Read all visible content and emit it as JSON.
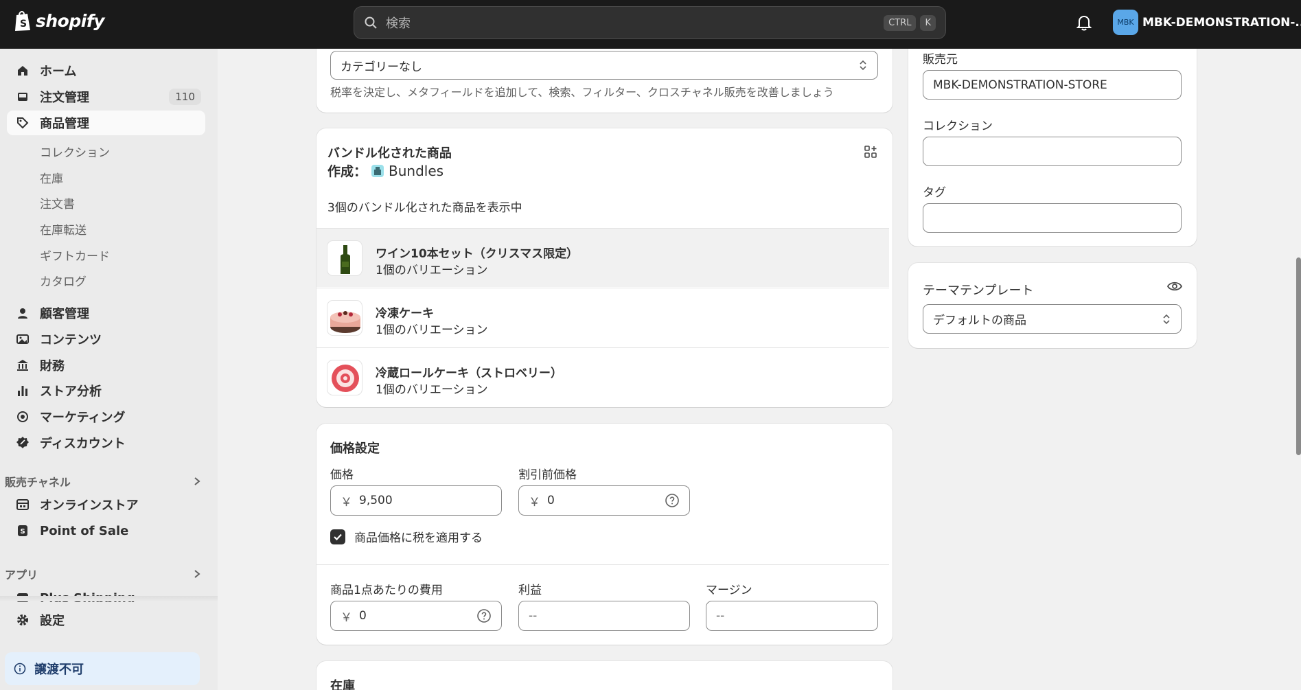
{
  "topbar": {
    "brand": "shopify",
    "search_placeholder": "検索",
    "shortcut_keys": [
      "CTRL",
      "K"
    ],
    "store_avatar": "MBK",
    "store_name": "MBK-DEMONSTRATION-..."
  },
  "sidebar": {
    "items": [
      {
        "label": "ホーム",
        "icon": "home-icon"
      },
      {
        "label": "注文管理",
        "icon": "inbox-icon",
        "badge": "110"
      },
      {
        "label": "商品管理",
        "icon": "tag-icon"
      }
    ],
    "product_subitems": [
      "コレクション",
      "在庫",
      "注文書",
      "在庫転送",
      "ギフトカード",
      "カタログ"
    ],
    "items2": [
      {
        "label": "顧客管理",
        "icon": "person-icon"
      },
      {
        "label": "コンテンツ",
        "icon": "image-icon"
      },
      {
        "label": "財務",
        "icon": "bank-icon"
      },
      {
        "label": "ストア分析",
        "icon": "bar-chart-icon"
      },
      {
        "label": "マーケティング",
        "icon": "target-icon"
      },
      {
        "label": "ディスカウント",
        "icon": "discount-icon"
      }
    ],
    "sales_channels_label": "販売チャネル",
    "channels": [
      {
        "label": "オンラインストア",
        "icon": "store-icon"
      },
      {
        "label": "Point of Sale",
        "icon": "pos-icon"
      }
    ],
    "apps_label": "アプリ",
    "apps": [
      {
        "label": "Plus Shipping",
        "icon": "app-icon"
      }
    ],
    "settings_label": "設定",
    "notice_label": "譲渡不可"
  },
  "category_card": {
    "select_value": "カテゴリーなし",
    "help_text": "税率を決定し、メタフィールドを追加して、検索、フィルター、クロスチャネル販売を改善しましょう"
  },
  "bundles_card": {
    "title": "バンドル化された商品",
    "created_by_label": "作成：",
    "created_by_app": "Bundles",
    "count_text": "3個のバンドル化された商品を表示中",
    "items": [
      {
        "name": "ワイン10本セット（クリスマス限定）",
        "variants": "1個のバリエーション"
      },
      {
        "name": "冷凍ケーキ",
        "variants": "1個のバリエーション"
      },
      {
        "name": "冷蔵ロールケーキ（ストロベリー）",
        "variants": "1個のバリエーション"
      }
    ]
  },
  "pricing_card": {
    "title": "価格設定",
    "price_label": "価格",
    "price_value": "9,500",
    "compare_label": "割引前価格",
    "compare_value": "0",
    "currency": "￥",
    "tax_checkbox_label": "商品価格に税を適用する",
    "tax_checked": true,
    "cost_label": "商品1点あたりの費用",
    "cost_value": "0",
    "profit_label": "利益",
    "profit_value": "--",
    "margin_label": "マージン",
    "margin_value": "--"
  },
  "inventory_card": {
    "title": "在庫"
  },
  "organization_card": {
    "vendor_label": "販売元",
    "vendor_value": "MBK-DEMONSTRATION-STORE",
    "collections_label": "コレクション",
    "collections_value": "",
    "tags_label": "タグ",
    "tags_value": ""
  },
  "theme_card": {
    "title": "テーマテンプレート",
    "select_value": "デフォルトの商品"
  }
}
